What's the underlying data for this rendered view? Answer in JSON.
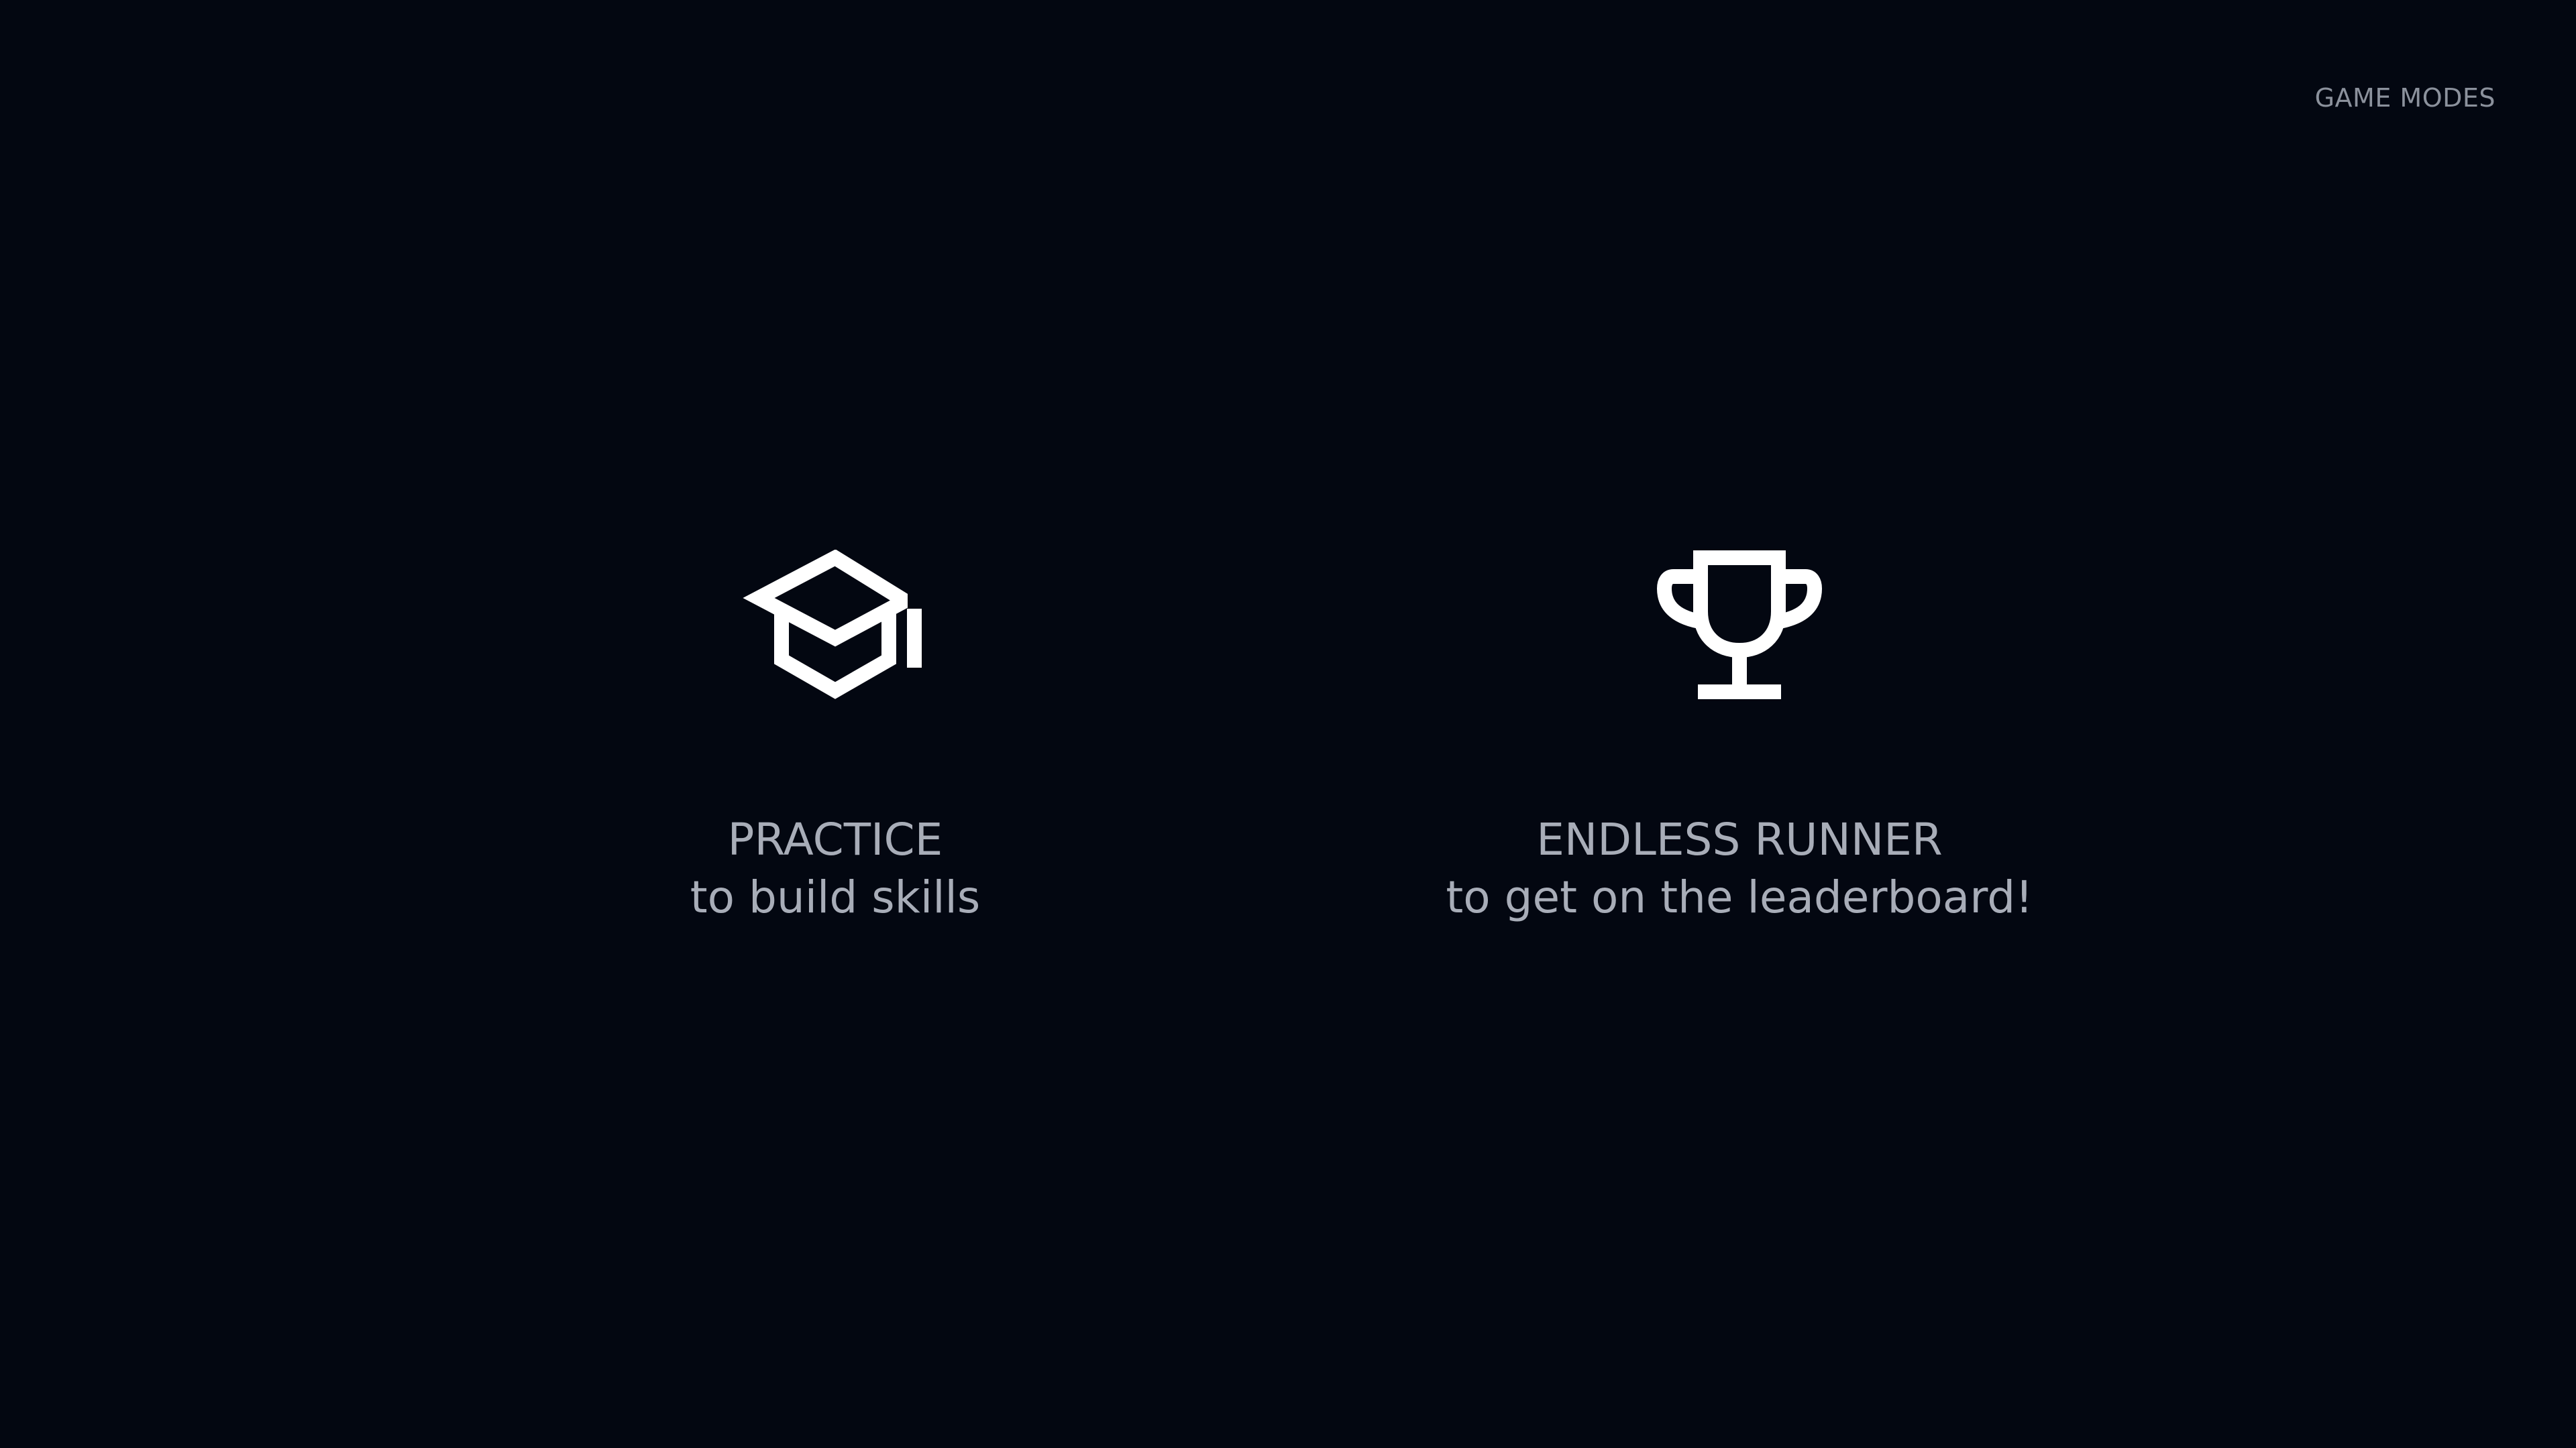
{
  "header": {
    "label": "GAME MODES"
  },
  "modes": [
    {
      "title": "PRACTICE",
      "subtitle": "to build skills",
      "icon": "graduation-cap-icon"
    },
    {
      "title": "ENDLESS RUNNER",
      "subtitle": "to get on the leaderboard!",
      "icon": "trophy-icon"
    }
  ],
  "colors": {
    "background": "#030711",
    "icon": "#ffffff",
    "text": "#a8adb8",
    "header_text": "#8b919c"
  }
}
